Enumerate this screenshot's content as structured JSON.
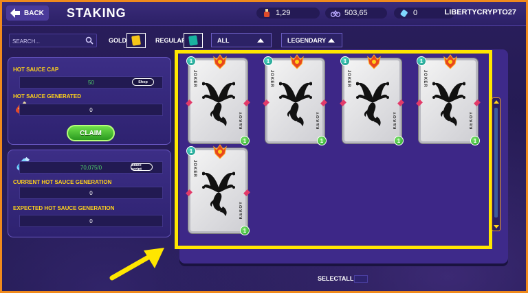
{
  "header": {
    "back_label": "BACK",
    "title": "STAKING",
    "stats": [
      {
        "icon": "hot-sauce-bottle-icon",
        "value": "1,29"
      },
      {
        "icon": "bike-icon",
        "value": "503,65"
      },
      {
        "icon": "potion-icon",
        "value": "0"
      }
    ],
    "username": "LIBERTYCRYPTO27"
  },
  "filters": {
    "search_placeholder": "SEARCH...",
    "gold_label": "GOLD",
    "regular_label": "REGULAR",
    "type_selected": "ALL",
    "rarity_selected": "LEGENDARY",
    "colors": {
      "gold_chip": "#f5c518",
      "regular_chip": "#19b3a0"
    }
  },
  "left_panel": {
    "cap_label": "HOT SAUCE CAP",
    "cap_value": "50",
    "shop_button": "Shop",
    "generated_label": "HOT SAUCE GENERATED",
    "generated_value": "0",
    "claim_button": "CLAIM",
    "stake_value": "70,075/0",
    "stake_button": "Stake script",
    "current_label": "CURRENT HOT SAUCE GENERATION",
    "current_value": "0",
    "expected_label": "EXPECTED HOT SAUCE GENERATION",
    "expected_value": "0"
  },
  "cards": [
    {
      "name": "JOKER",
      "rarity_text": "KEKOY",
      "level_top": "1",
      "level_bottom": "1"
    },
    {
      "name": "JOKER",
      "rarity_text": "KEKOY",
      "level_top": "1",
      "level_bottom": "1"
    },
    {
      "name": "JOKER",
      "rarity_text": "KEKOY",
      "level_top": "1",
      "level_bottom": "1"
    },
    {
      "name": "JOKER",
      "rarity_text": "KEKOY",
      "level_top": "1",
      "level_bottom": "1"
    },
    {
      "name": "JOKER",
      "rarity_text": "KEKOY",
      "level_top": "1",
      "level_bottom": "1"
    }
  ],
  "footer": {
    "select_all_label": "SELECTALL"
  },
  "accent_colors": {
    "highlight": "#ffe600",
    "frame": "#f08a1c",
    "label": "#ffd21a"
  }
}
